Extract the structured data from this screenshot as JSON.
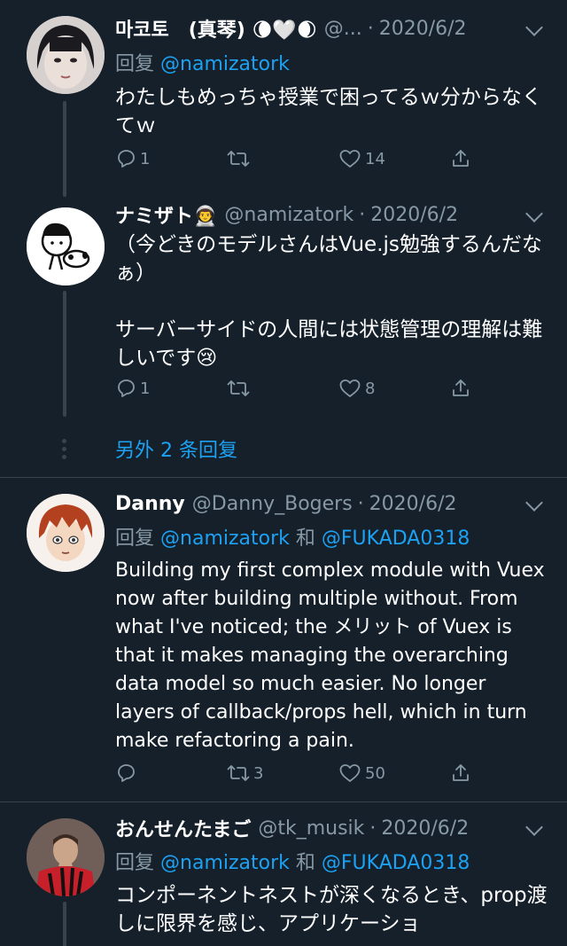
{
  "tweets": [
    {
      "display_name": "마코토　(真琴) 🌘🤍🌒",
      "handle": "@...",
      "date": "2020/6/2",
      "reply_prefix": "回复",
      "reply_to": [
        "@namizatork"
      ],
      "text": "わたしもめっちゃ授業で困ってるｗ分からなくてｗ",
      "replies": "1",
      "retweets": "",
      "likes": "14"
    },
    {
      "display_name": "ナミザト👨‍🚀",
      "handle": "@namizatork",
      "date": "2020/6/2",
      "text_lines": [
        "（今どきのモデルさんはVue.js勉強するんだなぁ）",
        "",
        "サーバーサイドの人間には状態管理の理解は難しいです😢"
      ],
      "replies": "1",
      "retweets": "",
      "likes": "8"
    },
    {
      "display_name": "Danny",
      "handle": "@Danny_Bogers",
      "date": "2020/6/2",
      "reply_prefix": "回复",
      "reply_to": [
        "@namizatork",
        "@FUKADA0318"
      ],
      "conjunction": "和",
      "text": "Building my first complex module with Vuex now after building multiple without. From what I've noticed; the メリット of Vuex is that it makes managing the overarching data model so much easier. No longer layers of callback/props hell, which in turn make refactoring a pain.",
      "replies": "",
      "retweets": "3",
      "likes": "50"
    },
    {
      "display_name": "おんせんたまご",
      "handle": "@tk_musik",
      "date": "2020/6/2",
      "reply_prefix": "回复",
      "reply_to": [
        "@namizatork",
        "@FUKADA0318"
      ],
      "conjunction": "和",
      "text": "コンポーネントネストが深くなるとき、prop渡しに限界を感じ、アプリケーショ",
      "replies": "",
      "retweets": "",
      "likes": ""
    }
  ],
  "more_replies_label": "另外 2 条回复",
  "icons": [
    "reply-icon",
    "retweet-icon",
    "like-icon",
    "share-icon",
    "chevron-down-icon"
  ],
  "colors": {
    "background": "#15202b",
    "link": "#1da1f2",
    "muted": "#8899a6",
    "divider": "#38444d"
  }
}
